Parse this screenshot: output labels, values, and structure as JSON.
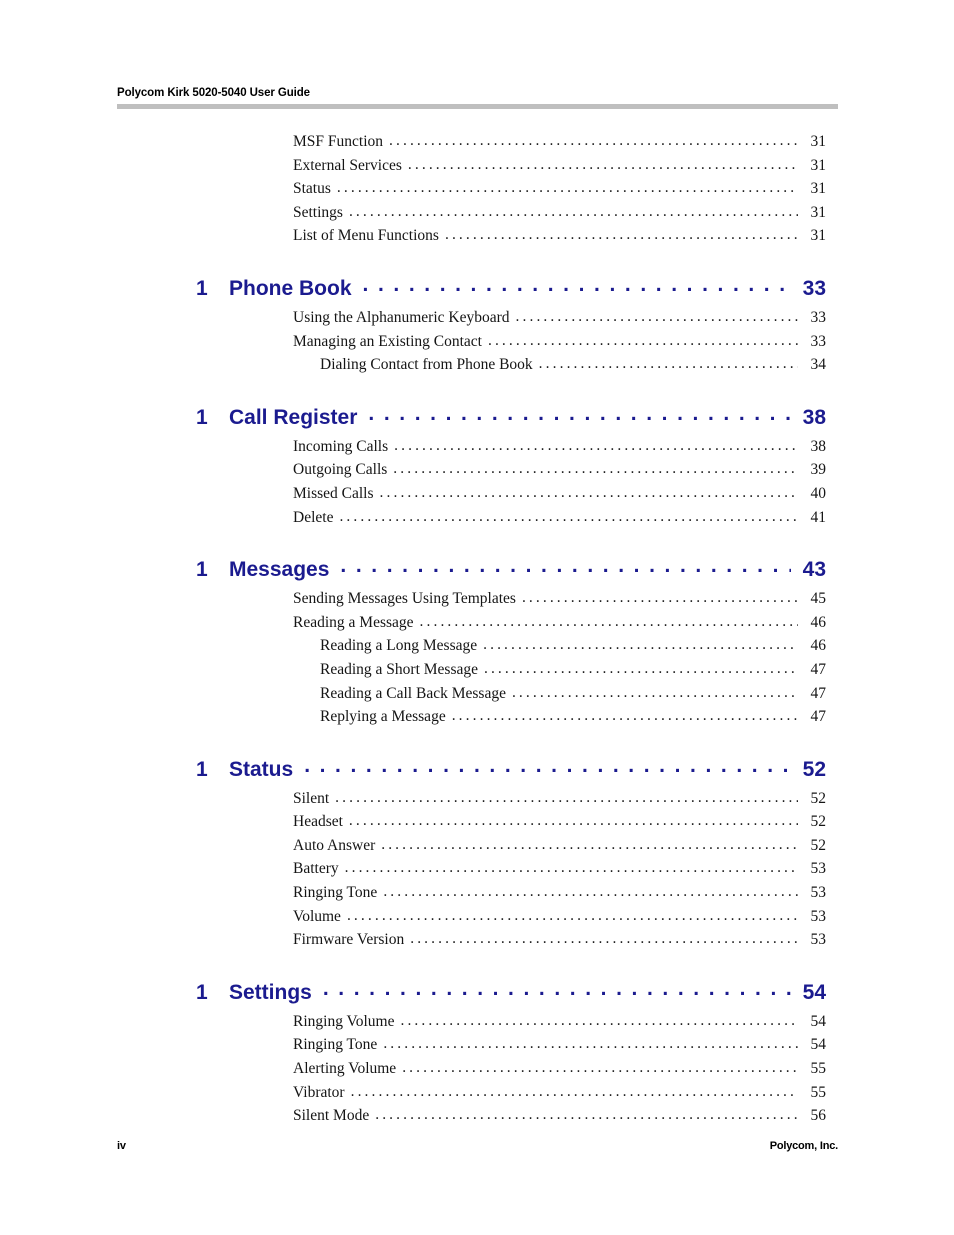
{
  "document": {
    "header_title": "Polycom Kirk 5020-5040 User Guide",
    "footer_page": "iv",
    "footer_company": "Polycom, Inc.",
    "accent_color": "#1b1b8f",
    "rule_color": "#bfbfbf",
    "text_color": "#151515"
  },
  "toc": {
    "leading_entries": [
      {
        "label": "MSF Function",
        "page": "31",
        "level": 2
      },
      {
        "label": "External Services",
        "page": "31",
        "level": 2
      },
      {
        "label": "Status",
        "page": "31",
        "level": 2
      },
      {
        "label": "Settings",
        "page": "31",
        "level": 2
      },
      {
        "label": "List of Menu Functions",
        "page": "31",
        "level": 2
      }
    ],
    "chapters": [
      {
        "number": "1",
        "title": "Phone Book",
        "page": "33",
        "entries": [
          {
            "label": "Using the Alphanumeric Keyboard",
            "page": "33",
            "level": 2
          },
          {
            "label": "Managing an Existing Contact",
            "page": "33",
            "level": 2
          },
          {
            "label": "Dialing Contact from Phone Book",
            "page": "34",
            "level": 3
          }
        ]
      },
      {
        "number": "1",
        "title": "Call Register",
        "page": "38",
        "entries": [
          {
            "label": "Incoming Calls",
            "page": "38",
            "level": 2
          },
          {
            "label": "Outgoing Calls",
            "page": "39",
            "level": 2
          },
          {
            "label": "Missed Calls",
            "page": "40",
            "level": 2
          },
          {
            "label": "Delete",
            "page": "41",
            "level": 2
          }
        ]
      },
      {
        "number": "1",
        "title": "Messages",
        "page": "43",
        "entries": [
          {
            "label": "Sending Messages Using Templates",
            "page": "45",
            "level": 2
          },
          {
            "label": "Reading a Message",
            "page": "46",
            "level": 2
          },
          {
            "label": "Reading a Long Message",
            "page": "46",
            "level": 3
          },
          {
            "label": "Reading a Short Message",
            "page": "47",
            "level": 3
          },
          {
            "label": "Reading a Call Back Message",
            "page": "47",
            "level": 3
          },
          {
            "label": "Replying a Message",
            "page": "47",
            "level": 3
          }
        ]
      },
      {
        "number": "1",
        "title": "Status",
        "page": "52",
        "entries": [
          {
            "label": "Silent",
            "page": "52",
            "level": 2
          },
          {
            "label": "Headset",
            "page": "52",
            "level": 2
          },
          {
            "label": "Auto Answer",
            "page": "52",
            "level": 2
          },
          {
            "label": "Battery",
            "page": "53",
            "level": 2
          },
          {
            "label": "Ringing Tone",
            "page": "53",
            "level": 2
          },
          {
            "label": "Volume",
            "page": "53",
            "level": 2
          },
          {
            "label": "Firmware Version",
            "page": "53",
            "level": 2
          }
        ]
      },
      {
        "number": "1",
        "title": "Settings",
        "page": "54",
        "entries": [
          {
            "label": "Ringing Volume",
            "page": "54",
            "level": 2
          },
          {
            "label": "Ringing Tone",
            "page": "54",
            "level": 2
          },
          {
            "label": "Alerting Volume",
            "page": "55",
            "level": 2
          },
          {
            "label": "Vibrator",
            "page": "55",
            "level": 2
          },
          {
            "label": "Silent Mode",
            "page": "56",
            "level": 2
          }
        ]
      }
    ]
  }
}
